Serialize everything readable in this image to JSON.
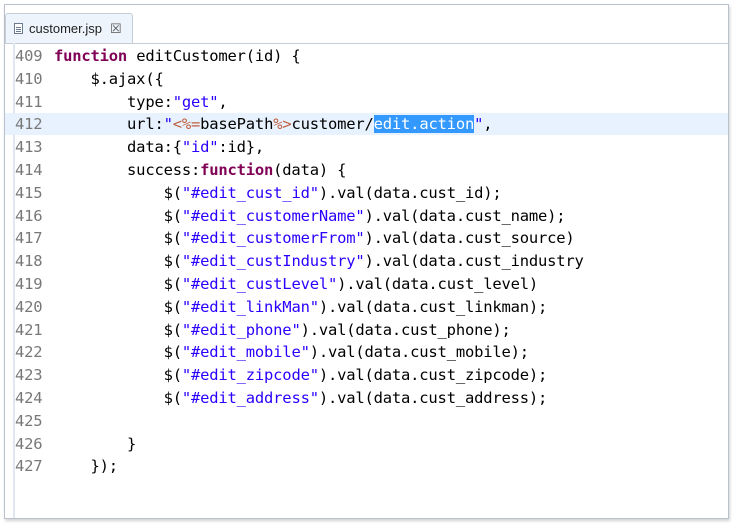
{
  "tab": {
    "filename": "customer.jsp",
    "close": "☒"
  },
  "lines": [
    {
      "n": "409",
      "segs": [
        [
          "kw",
          "function"
        ],
        [
          "t",
          " editCustomer(id) {"
        ]
      ]
    },
    {
      "n": "410",
      "segs": [
        [
          "t",
          "    $.ajax({"
        ]
      ]
    },
    {
      "n": "411",
      "segs": [
        [
          "t",
          "        type:"
        ],
        [
          "str",
          "\"get\""
        ],
        [
          "t",
          ","
        ]
      ]
    },
    {
      "n": "412",
      "current": true,
      "segs": [
        [
          "t",
          "        url:"
        ],
        [
          "str",
          "\""
        ],
        [
          "tag",
          "<%="
        ],
        [
          "t",
          "basePath"
        ],
        [
          "tag",
          "%>"
        ],
        [
          "t",
          "customer/"
        ],
        [
          "sel",
          "edit.action"
        ],
        [
          "str",
          "\""
        ],
        [
          "t",
          ","
        ]
      ]
    },
    {
      "n": "413",
      "segs": [
        [
          "t",
          "        data:{"
        ],
        [
          "str",
          "\"id\""
        ],
        [
          "t",
          ":id},"
        ]
      ]
    },
    {
      "n": "414",
      "segs": [
        [
          "t",
          "        success:"
        ],
        [
          "kw",
          "function"
        ],
        [
          "t",
          "(data) {"
        ]
      ]
    },
    {
      "n": "415",
      "segs": [
        [
          "t",
          "            $("
        ],
        [
          "str",
          "\"#edit_cust_id\""
        ],
        [
          "t",
          ").val(data.cust_id);"
        ]
      ]
    },
    {
      "n": "416",
      "segs": [
        [
          "t",
          "            $("
        ],
        [
          "str",
          "\"#edit_customerName\""
        ],
        [
          "t",
          ").val(data.cust_name);"
        ]
      ]
    },
    {
      "n": "417",
      "segs": [
        [
          "t",
          "            $("
        ],
        [
          "str",
          "\"#edit_customerFrom\""
        ],
        [
          "t",
          ").val(data.cust_source)"
        ]
      ]
    },
    {
      "n": "418",
      "segs": [
        [
          "t",
          "            $("
        ],
        [
          "str",
          "\"#edit_custIndustry\""
        ],
        [
          "t",
          ").val(data.cust_industry"
        ]
      ]
    },
    {
      "n": "419",
      "segs": [
        [
          "t",
          "            $("
        ],
        [
          "str",
          "\"#edit_custLevel\""
        ],
        [
          "t",
          ").val(data.cust_level)"
        ]
      ]
    },
    {
      "n": "420",
      "segs": [
        [
          "t",
          "            $("
        ],
        [
          "str",
          "\"#edit_linkMan\""
        ],
        [
          "t",
          ").val(data.cust_linkman);"
        ]
      ]
    },
    {
      "n": "421",
      "segs": [
        [
          "t",
          "            $("
        ],
        [
          "str",
          "\"#edit_phone\""
        ],
        [
          "t",
          ").val(data.cust_phone);"
        ]
      ]
    },
    {
      "n": "422",
      "segs": [
        [
          "t",
          "            $("
        ],
        [
          "str",
          "\"#edit_mobile\""
        ],
        [
          "t",
          ").val(data.cust_mobile);"
        ]
      ]
    },
    {
      "n": "423",
      "segs": [
        [
          "t",
          "            $("
        ],
        [
          "str",
          "\"#edit_zipcode\""
        ],
        [
          "t",
          ").val(data.cust_zipcode);"
        ]
      ]
    },
    {
      "n": "424",
      "segs": [
        [
          "t",
          "            $("
        ],
        [
          "str",
          "\"#edit_address\""
        ],
        [
          "t",
          ").val(data.cust_address);"
        ]
      ]
    },
    {
      "n": "425",
      "segs": []
    },
    {
      "n": "426",
      "segs": [
        [
          "t",
          "        }"
        ]
      ]
    },
    {
      "n": "427",
      "segs": [
        [
          "t",
          "    });"
        ]
      ]
    }
  ]
}
